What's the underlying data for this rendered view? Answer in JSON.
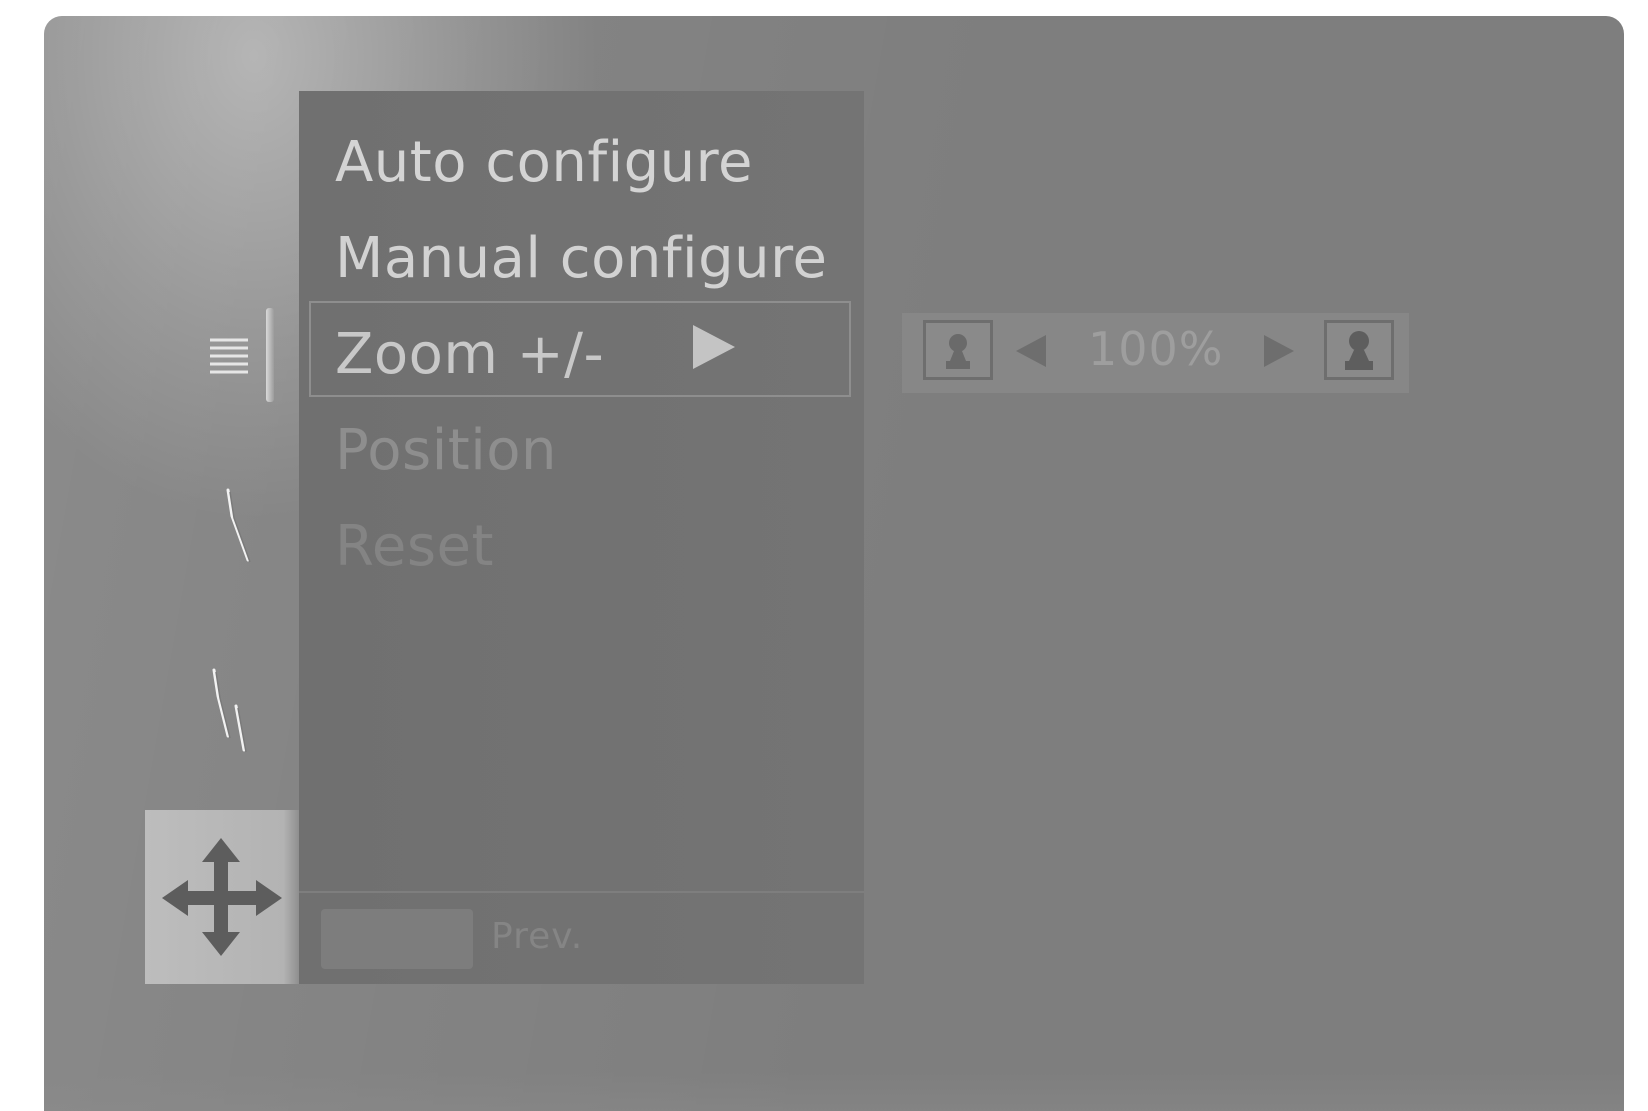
{
  "menu": {
    "items": [
      {
        "label": "Auto configure",
        "state": "enabled"
      },
      {
        "label": "Manual configure",
        "state": "enabled"
      },
      {
        "label": "Zoom +/-",
        "state": "selected"
      },
      {
        "label": "Position",
        "state": "dimmed"
      },
      {
        "label": "Reset",
        "state": "dimmed"
      }
    ],
    "selected_indicator_icon": "right-triangle-icon"
  },
  "footer": {
    "prev_label": "Prev."
  },
  "zoom_control": {
    "value": "100%",
    "left_icon": "zoom-out-person-icon",
    "right_icon": "zoom-in-person-icon",
    "decrease_icon": "left-triangle-icon",
    "increase_icon": "right-triangle-icon"
  },
  "sidebar": {
    "icons": [
      {
        "name": "menu-lines-icon",
        "active": true
      },
      {
        "name": "single-slash-icon",
        "active": false
      },
      {
        "name": "double-slash-icon",
        "active": false
      },
      {
        "name": "move-arrows-icon",
        "active": true
      }
    ]
  },
  "colors": {
    "screen_bg": "#7e7e7e",
    "panel_bg": "#727272",
    "text_bright": "#d4d4d4",
    "text_dim": "#8e8e8e"
  }
}
